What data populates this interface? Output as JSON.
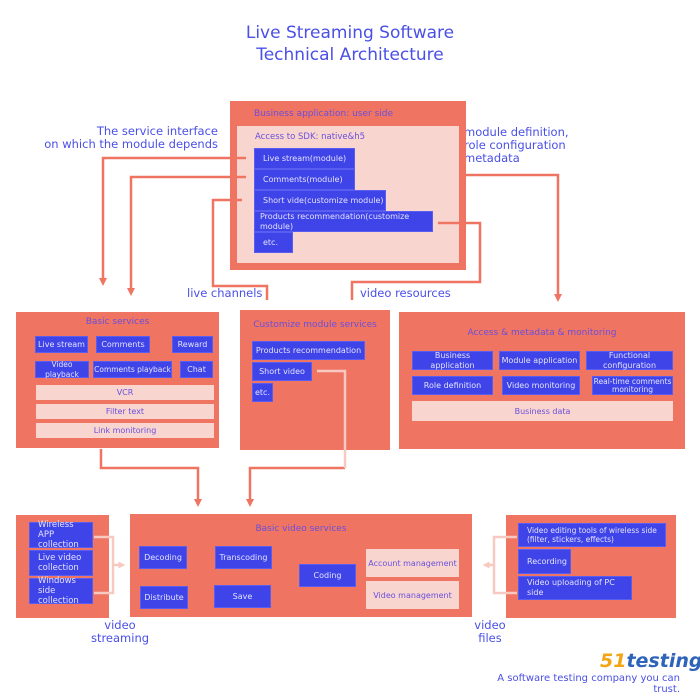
{
  "title": {
    "line1": "Live Streaming Software",
    "line2": "Technical Architecture"
  },
  "labels": {
    "service_interface_1": "The service interface",
    "service_interface_2": "on which the module depends",
    "module_def_1": "module definition,",
    "module_def_2": "role configuration",
    "module_def_3": "metadata",
    "live_channels": "live channels",
    "video_resources": "video resources",
    "video_streaming_1": "video",
    "video_streaming_2": "streaming",
    "video_files_1": "video",
    "video_files_2": "files"
  },
  "business_app": {
    "title": "Business application: user side",
    "sdk_title": "Access to SDK: native&h5",
    "modules": [
      "Live stream(module)",
      "Comments(module)",
      "Short vide(customize module)",
      "Products recommendation(customize module)",
      "etc."
    ]
  },
  "basic_services": {
    "title": "Basic services",
    "row1": [
      "Live stream",
      "Comments",
      "Reward"
    ],
    "row2": [
      "Video playback",
      "Comments playback",
      "Chat"
    ],
    "bars": [
      "VCR",
      "Filter text",
      "Link monitoring"
    ]
  },
  "customize_services": {
    "title": "Customize module services",
    "items": [
      "Products recommendation",
      "Short video",
      "etc."
    ]
  },
  "access_metadata": {
    "title": "Access & metadata & monitoring",
    "row1": [
      "Business application",
      "Module application",
      "Functional configuration"
    ],
    "row2": [
      "Role definition",
      "Video monitoring",
      "Real-time comments monitoring"
    ],
    "bar": "Business data"
  },
  "collection": {
    "items": [
      "Wireless APP collection",
      "Live video collection",
      "Windows side collection"
    ]
  },
  "basic_video": {
    "title": "Basic video services",
    "items": [
      "Decoding",
      "Transcoding",
      "Distribute",
      "Save",
      "Coding"
    ],
    "management": [
      "Account management",
      "Video management"
    ]
  },
  "editing": {
    "items": [
      "Video editing tools of wireless side (filter, stickers, effects)",
      "Recording",
      "Video uploading of PC side"
    ]
  },
  "footer": {
    "logo_num": "51",
    "logo_text": "testing",
    "tagline": "A software testing company you can trust."
  },
  "colors": {
    "panel": "#ef7462",
    "inner": "#f8d6cf",
    "module_blue": "#3f44e8",
    "text_blue": "#4a4fe6",
    "title_purple": "#6a4fdc"
  }
}
